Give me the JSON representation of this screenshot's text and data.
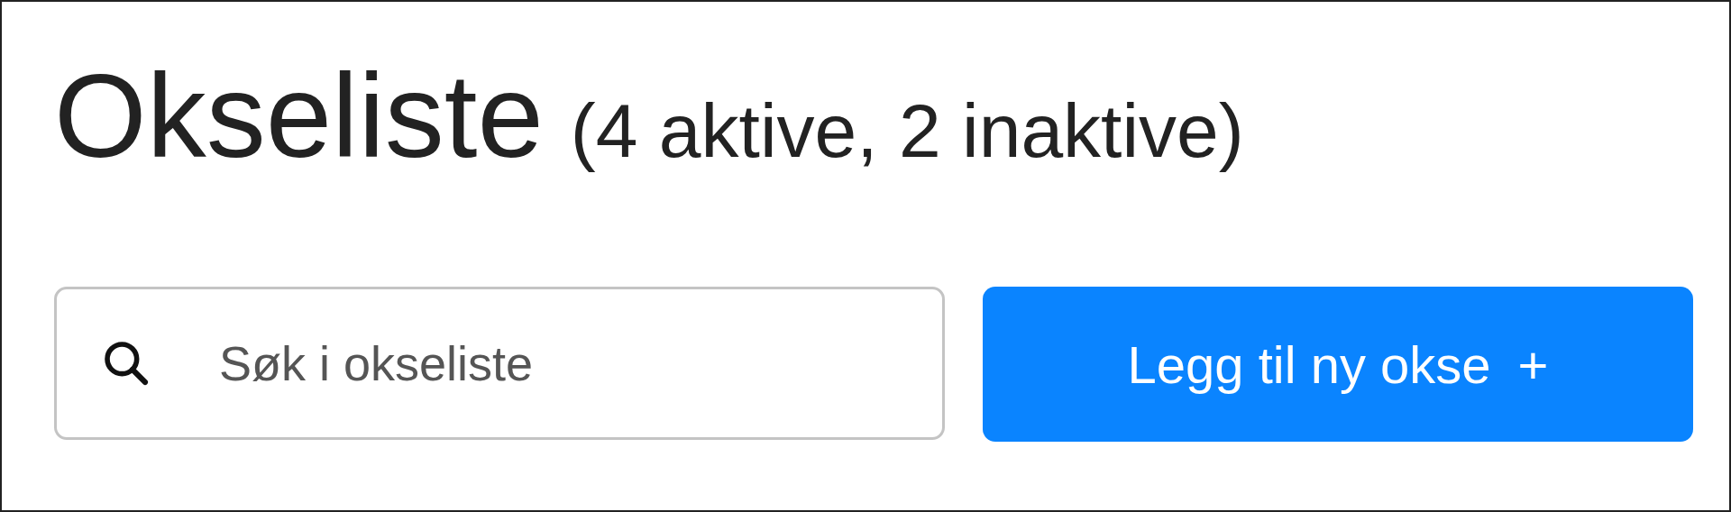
{
  "heading": {
    "title": "Okseliste",
    "summary": "(4 aktive, 2 inaktive)"
  },
  "search": {
    "placeholder": "Søk i okseliste"
  },
  "add_button": {
    "label": "Legg til ny okse",
    "icon": "+"
  }
}
